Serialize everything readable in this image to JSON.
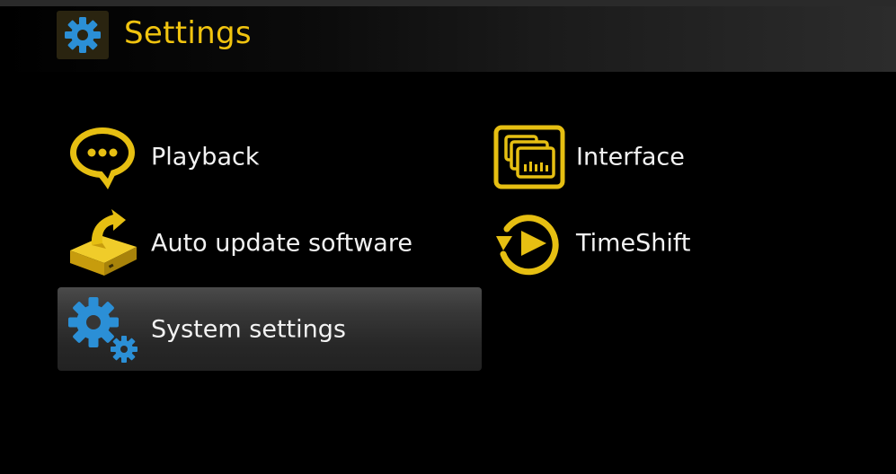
{
  "header": {
    "title": "Settings",
    "icon": "gear-icon"
  },
  "colors": {
    "accent": "#f1c40f",
    "gear_blue": "#2b8fd6",
    "text": "#f2f2f2",
    "background": "#000000",
    "selected_row": "#333333"
  },
  "menu": {
    "items": [
      {
        "label": "Playback",
        "icon": "speech-bubble-icon"
      },
      {
        "label": "Interface",
        "icon": "interface-screens-icon"
      },
      {
        "label": "Auto update software",
        "icon": "software-update-box-icon"
      },
      {
        "label": "TimeShift",
        "icon": "timeshift-play-icon"
      },
      {
        "label": "System settings",
        "icon": "gears-icon",
        "selected": true
      }
    ]
  }
}
